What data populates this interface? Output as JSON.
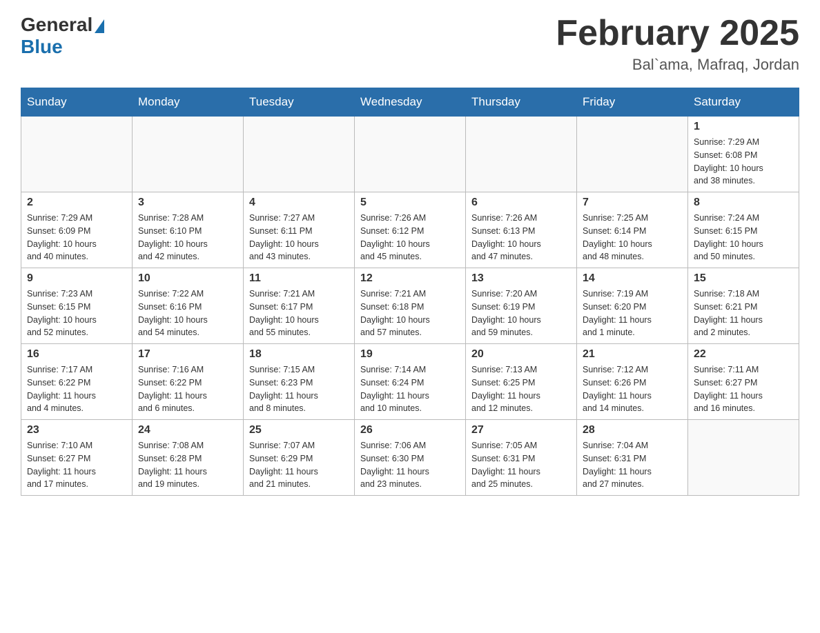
{
  "header": {
    "logo_general": "General",
    "logo_blue": "Blue",
    "month_title": "February 2025",
    "location": "Bal`ama, Mafraq, Jordan"
  },
  "weekdays": [
    "Sunday",
    "Monday",
    "Tuesday",
    "Wednesday",
    "Thursday",
    "Friday",
    "Saturday"
  ],
  "weeks": [
    [
      {
        "day": "",
        "info": ""
      },
      {
        "day": "",
        "info": ""
      },
      {
        "day": "",
        "info": ""
      },
      {
        "day": "",
        "info": ""
      },
      {
        "day": "",
        "info": ""
      },
      {
        "day": "",
        "info": ""
      },
      {
        "day": "1",
        "info": "Sunrise: 7:29 AM\nSunset: 6:08 PM\nDaylight: 10 hours\nand 38 minutes."
      }
    ],
    [
      {
        "day": "2",
        "info": "Sunrise: 7:29 AM\nSunset: 6:09 PM\nDaylight: 10 hours\nand 40 minutes."
      },
      {
        "day": "3",
        "info": "Sunrise: 7:28 AM\nSunset: 6:10 PM\nDaylight: 10 hours\nand 42 minutes."
      },
      {
        "day": "4",
        "info": "Sunrise: 7:27 AM\nSunset: 6:11 PM\nDaylight: 10 hours\nand 43 minutes."
      },
      {
        "day": "5",
        "info": "Sunrise: 7:26 AM\nSunset: 6:12 PM\nDaylight: 10 hours\nand 45 minutes."
      },
      {
        "day": "6",
        "info": "Sunrise: 7:26 AM\nSunset: 6:13 PM\nDaylight: 10 hours\nand 47 minutes."
      },
      {
        "day": "7",
        "info": "Sunrise: 7:25 AM\nSunset: 6:14 PM\nDaylight: 10 hours\nand 48 minutes."
      },
      {
        "day": "8",
        "info": "Sunrise: 7:24 AM\nSunset: 6:15 PM\nDaylight: 10 hours\nand 50 minutes."
      }
    ],
    [
      {
        "day": "9",
        "info": "Sunrise: 7:23 AM\nSunset: 6:15 PM\nDaylight: 10 hours\nand 52 minutes."
      },
      {
        "day": "10",
        "info": "Sunrise: 7:22 AM\nSunset: 6:16 PM\nDaylight: 10 hours\nand 54 minutes."
      },
      {
        "day": "11",
        "info": "Sunrise: 7:21 AM\nSunset: 6:17 PM\nDaylight: 10 hours\nand 55 minutes."
      },
      {
        "day": "12",
        "info": "Sunrise: 7:21 AM\nSunset: 6:18 PM\nDaylight: 10 hours\nand 57 minutes."
      },
      {
        "day": "13",
        "info": "Sunrise: 7:20 AM\nSunset: 6:19 PM\nDaylight: 10 hours\nand 59 minutes."
      },
      {
        "day": "14",
        "info": "Sunrise: 7:19 AM\nSunset: 6:20 PM\nDaylight: 11 hours\nand 1 minute."
      },
      {
        "day": "15",
        "info": "Sunrise: 7:18 AM\nSunset: 6:21 PM\nDaylight: 11 hours\nand 2 minutes."
      }
    ],
    [
      {
        "day": "16",
        "info": "Sunrise: 7:17 AM\nSunset: 6:22 PM\nDaylight: 11 hours\nand 4 minutes."
      },
      {
        "day": "17",
        "info": "Sunrise: 7:16 AM\nSunset: 6:22 PM\nDaylight: 11 hours\nand 6 minutes."
      },
      {
        "day": "18",
        "info": "Sunrise: 7:15 AM\nSunset: 6:23 PM\nDaylight: 11 hours\nand 8 minutes."
      },
      {
        "day": "19",
        "info": "Sunrise: 7:14 AM\nSunset: 6:24 PM\nDaylight: 11 hours\nand 10 minutes."
      },
      {
        "day": "20",
        "info": "Sunrise: 7:13 AM\nSunset: 6:25 PM\nDaylight: 11 hours\nand 12 minutes."
      },
      {
        "day": "21",
        "info": "Sunrise: 7:12 AM\nSunset: 6:26 PM\nDaylight: 11 hours\nand 14 minutes."
      },
      {
        "day": "22",
        "info": "Sunrise: 7:11 AM\nSunset: 6:27 PM\nDaylight: 11 hours\nand 16 minutes."
      }
    ],
    [
      {
        "day": "23",
        "info": "Sunrise: 7:10 AM\nSunset: 6:27 PM\nDaylight: 11 hours\nand 17 minutes."
      },
      {
        "day": "24",
        "info": "Sunrise: 7:08 AM\nSunset: 6:28 PM\nDaylight: 11 hours\nand 19 minutes."
      },
      {
        "day": "25",
        "info": "Sunrise: 7:07 AM\nSunset: 6:29 PM\nDaylight: 11 hours\nand 21 minutes."
      },
      {
        "day": "26",
        "info": "Sunrise: 7:06 AM\nSunset: 6:30 PM\nDaylight: 11 hours\nand 23 minutes."
      },
      {
        "day": "27",
        "info": "Sunrise: 7:05 AM\nSunset: 6:31 PM\nDaylight: 11 hours\nand 25 minutes."
      },
      {
        "day": "28",
        "info": "Sunrise: 7:04 AM\nSunset: 6:31 PM\nDaylight: 11 hours\nand 27 minutes."
      },
      {
        "day": "",
        "info": ""
      }
    ]
  ]
}
